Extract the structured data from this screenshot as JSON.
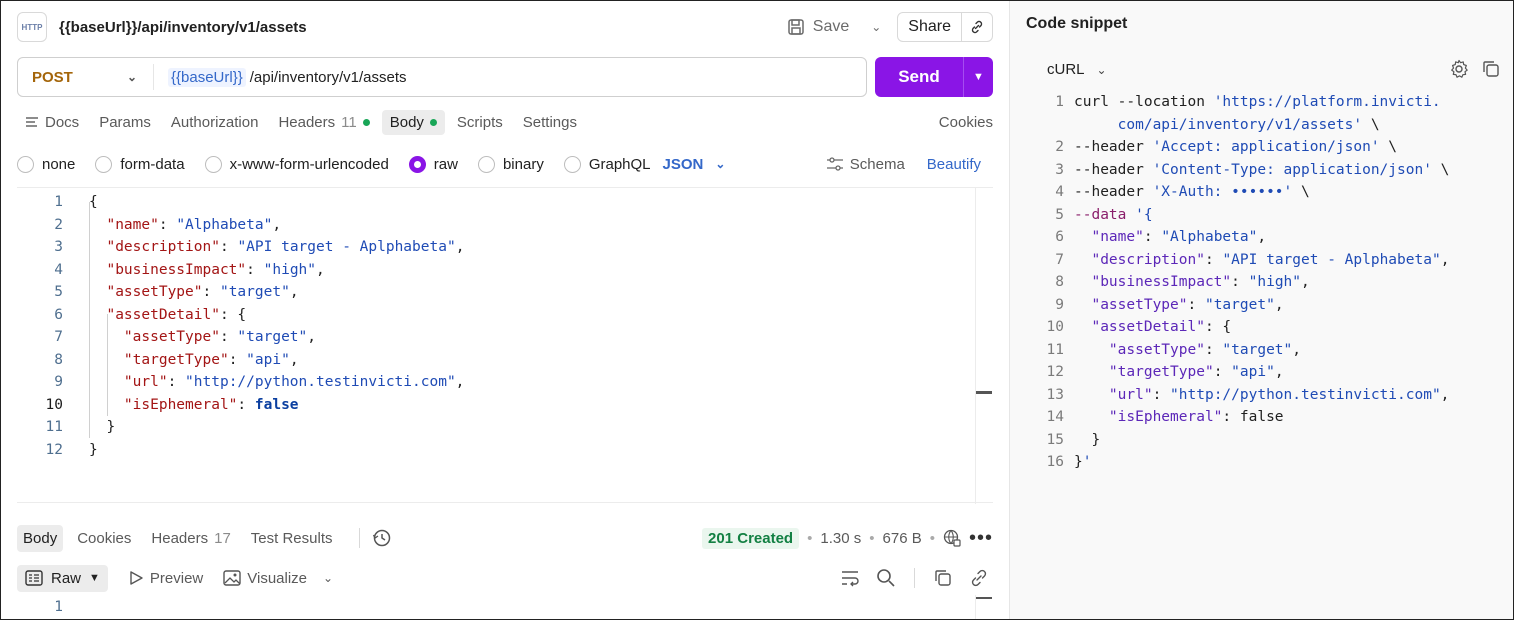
{
  "request": {
    "title": "{{baseUrl}}/api/inventory/v1/assets",
    "save_label": "Save",
    "share_label": "Share",
    "method": "POST",
    "url_variable": "{{baseUrl}}",
    "url_path": "/api/inventory/v1/assets",
    "send_label": "Send"
  },
  "req_tabs": [
    {
      "label": "Docs"
    },
    {
      "label": "Params"
    },
    {
      "label": "Authorization"
    },
    {
      "label": "Headers",
      "count": "11"
    },
    {
      "label": "Body"
    },
    {
      "label": "Scripts"
    },
    {
      "label": "Settings"
    }
  ],
  "cookies_label": "Cookies",
  "body_modes": [
    "none",
    "form-data",
    "x-www-form-urlencoded",
    "raw",
    "binary",
    "GraphQL"
  ],
  "body_format": "JSON",
  "schema_label": "Schema",
  "beautify_label": "Beautify",
  "editor": {
    "line_numbers": [
      "1",
      "2",
      "3",
      "4",
      "5",
      "6",
      "7",
      "8",
      "9",
      "10",
      "11",
      "12"
    ],
    "lines": [
      "{",
      "  \"name\": \"Alphabeta\",",
      "  \"description\": \"API target - Aplphabeta\",",
      "  \"businessImpact\": \"high\",",
      "  \"assetType\": \"target\",",
      "  \"assetDetail\": {",
      "    \"assetType\": \"target\",",
      "    \"targetType\": \"api\",",
      "    \"url\": \"http://python.testinvicti.com\",",
      "    \"isEphemeral\": false",
      "  }",
      "}"
    ]
  },
  "response": {
    "tabs": [
      {
        "label": "Body"
      },
      {
        "label": "Cookies"
      },
      {
        "label": "Headers",
        "count": "17"
      },
      {
        "label": "Test Results"
      }
    ],
    "status": "201 Created",
    "time": "1.30 s",
    "size": "676 B",
    "view_mode": "Raw",
    "preview_label": "Preview",
    "visualize_label": "Visualize",
    "first_line": "1"
  },
  "snippet": {
    "title": "Code snippet",
    "language": "cURL",
    "line_numbers": [
      "1",
      "",
      "2",
      "3",
      "4",
      "5",
      "6",
      "7",
      "8",
      "9",
      "10",
      "11",
      "12",
      "13",
      "14",
      "15",
      "16"
    ],
    "lines": [
      "curl --location 'https://platform.invicti.",
      "     com/api/inventory/v1/assets' \\",
      "--header 'Accept: application/json' \\",
      "--header 'Content-Type: application/json' \\",
      "--header 'X-Auth: ••••••' \\",
      "--data '{",
      "  \"name\": \"Alphabeta\",",
      "  \"description\": \"API target - Aplphabeta\",",
      "  \"businessImpact\": \"high\",",
      "  \"assetType\": \"target\",",
      "  \"assetDetail\": {",
      "    \"assetType\": \"target\",",
      "    \"targetType\": \"api\",",
      "    \"url\": \"http://python.testinvicti.com\",",
      "    \"isEphemeral\": false",
      "  }",
      "}'"
    ]
  },
  "colors": {
    "accent": "#8a15e6",
    "method": "#a4650a",
    "status_ok": "#138043"
  }
}
